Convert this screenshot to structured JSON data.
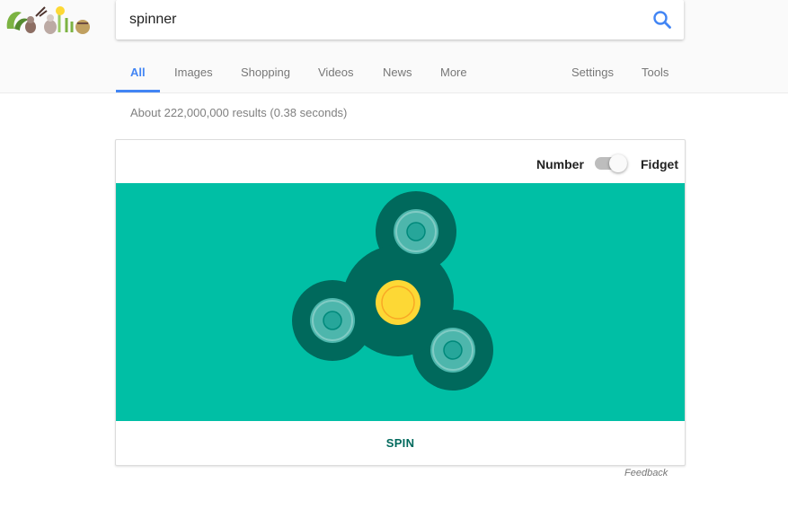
{
  "search": {
    "query": "spinner"
  },
  "tabs": [
    "All",
    "Images",
    "Shopping",
    "Videos",
    "News",
    "More"
  ],
  "tools": [
    "Settings",
    "Tools"
  ],
  "results": {
    "stats": "About 222,000,000 results (0.38 seconds)"
  },
  "widget": {
    "left_label": "Number",
    "right_label": "Fidget",
    "mode": "Fidget",
    "spin_label": "SPIN"
  },
  "footer": {
    "feedback": "Feedback"
  },
  "colors": {
    "stage": "#00bfa5",
    "spinner_body": "#00695c",
    "center": "#fdd835",
    "accent": "#4285f4"
  }
}
